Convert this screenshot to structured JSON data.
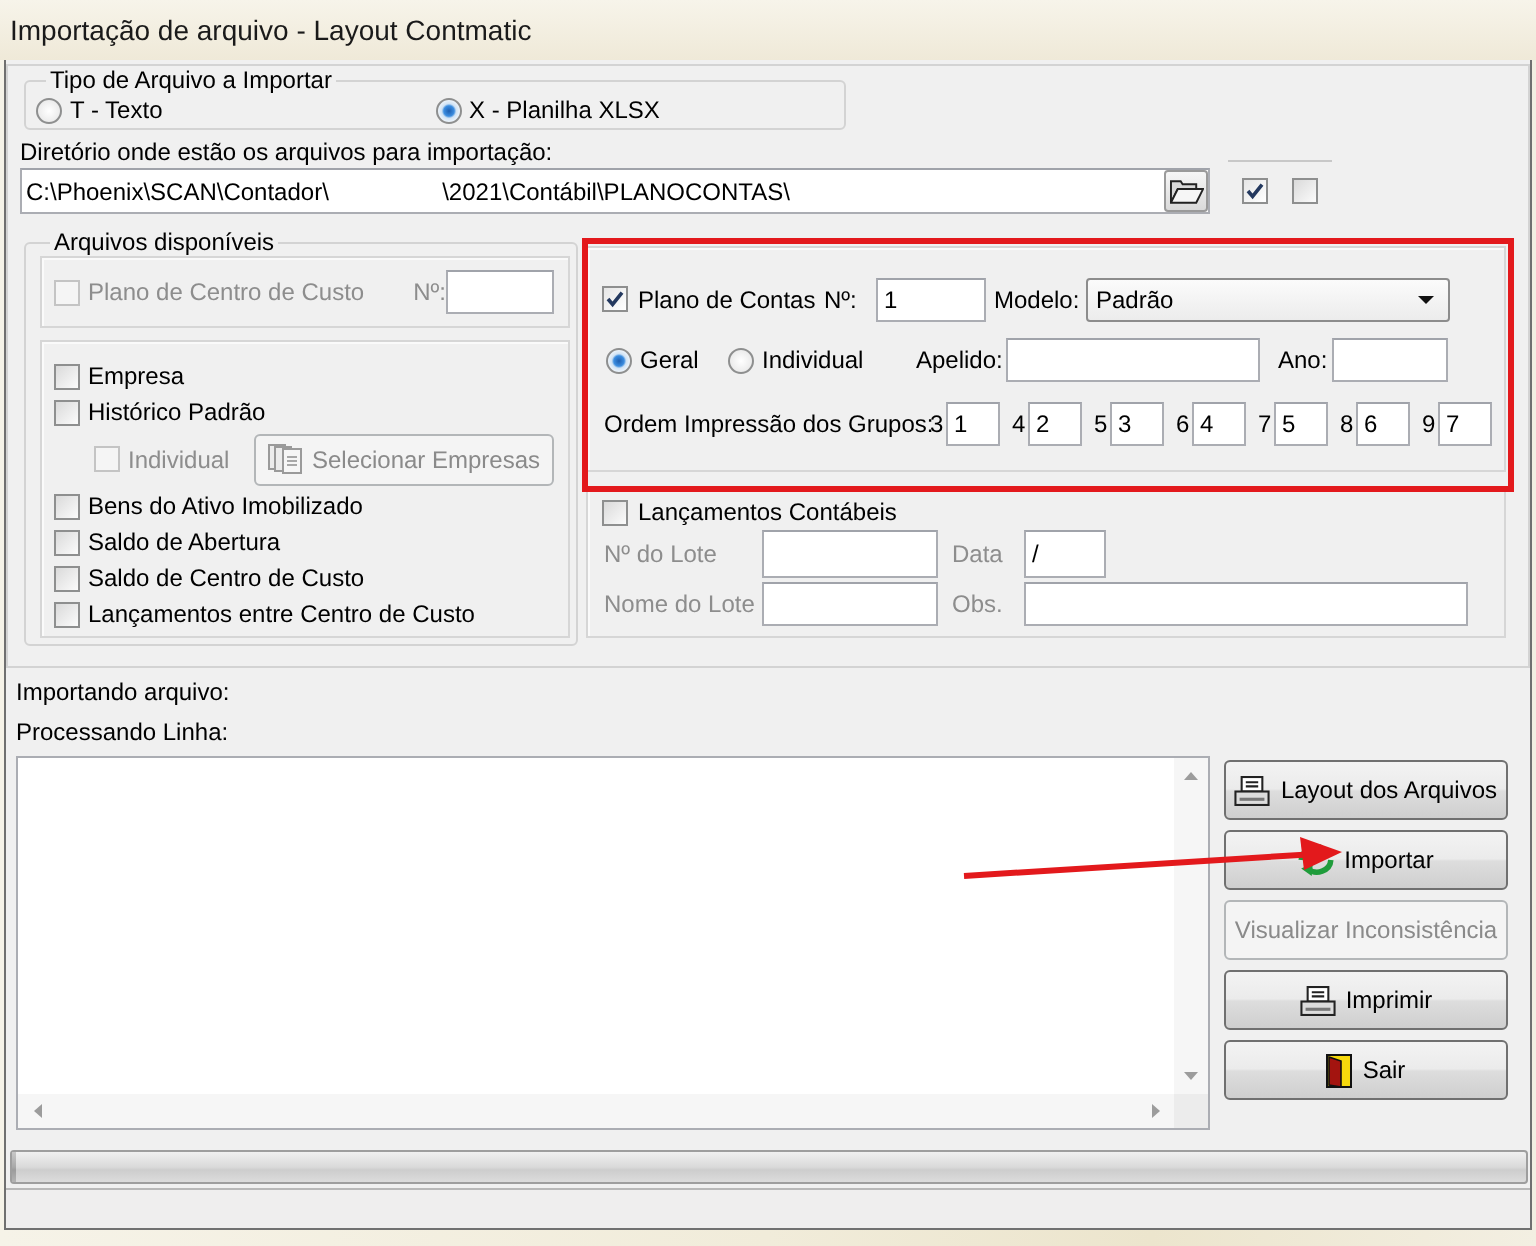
{
  "window": {
    "title": "Importação de arquivo - Layout Contmatic"
  },
  "file_type": {
    "legend": "Tipo de Arquivo a Importar",
    "options": [
      {
        "label": "T - Texto",
        "selected": false
      },
      {
        "label": "X - Planilha XLSX",
        "selected": true
      }
    ]
  },
  "directory": {
    "label": "Diretório onde estão os arquivos para importação:",
    "value": "C:\\Phoenix\\SCAN\\Contador\\                 \\2021\\Contábil\\PLANOCONTAS\\",
    "toggles": [
      {
        "checked": true
      },
      {
        "checked": false
      }
    ]
  },
  "available_files": {
    "legend": "Arquivos disponíveis",
    "cost_center_plan": {
      "label": "Plano de Centro de Custo",
      "number_label": "Nº:",
      "checked": false,
      "disabled": true
    },
    "items": [
      {
        "kind": "checkbox",
        "label": "Empresa",
        "checked": false,
        "disabled": false
      },
      {
        "kind": "checkbox",
        "label": "Histórico Padrão",
        "checked": false,
        "disabled": false
      },
      {
        "kind": "sub_option",
        "label": "Individual",
        "checked": false,
        "disabled": true,
        "button": {
          "label": "Selecionar Empresas",
          "disabled": true
        }
      },
      {
        "kind": "checkbox",
        "label": "Bens do Ativo Imobilizado",
        "checked": false,
        "disabled": false
      },
      {
        "kind": "checkbox",
        "label": "Saldo de Abertura",
        "checked": false,
        "disabled": false
      },
      {
        "kind": "checkbox",
        "label": "Saldo de Centro de Custo",
        "checked": false,
        "disabled": false
      },
      {
        "kind": "checkbox",
        "label": "Lançamentos entre Centro de Custo",
        "checked": false,
        "disabled": false
      }
    ]
  },
  "chart_of_accounts": {
    "label": "Plano de Contas",
    "checked": true,
    "number_label": "Nº:",
    "number": "1",
    "model_label": "Modelo:",
    "model": "Padrão",
    "scope": [
      {
        "label": "Geral",
        "selected": true
      },
      {
        "label": "Individual",
        "selected": false
      }
    ],
    "nickname_label": "Apelido:",
    "year_label": "Ano:",
    "order_label": "Ordem Impressão dos Grupos:",
    "order": [
      {
        "group": "3",
        "value": "1"
      },
      {
        "group": "4",
        "value": "2"
      },
      {
        "group": "5",
        "value": "3"
      },
      {
        "group": "6",
        "value": "4"
      },
      {
        "group": "7",
        "value": "5"
      },
      {
        "group": "8",
        "value": "6"
      },
      {
        "group": "9",
        "value": "7"
      }
    ]
  },
  "accounting_entries": {
    "label": "Lançamentos Contábeis",
    "checked": false,
    "fields_disabled": true,
    "batch_number_label": "Nº do Lote",
    "date_label": "Data",
    "date": "/",
    "batch_name_label": "Nome do Lote",
    "notes_label": "Obs."
  },
  "import_status": {
    "file_label": "Importando arquivo:",
    "line_label": "Processando Linha:"
  },
  "buttons": [
    {
      "kind": "layout",
      "label": "Layout dos Arquivos",
      "disabled": false
    },
    {
      "kind": "import",
      "label": "Importar",
      "disabled": false
    },
    {
      "kind": "inconsistency",
      "label": "Visualizar Inconsistência",
      "disabled": true
    },
    {
      "kind": "print",
      "label": "Imprimir",
      "disabled": false
    },
    {
      "kind": "exit",
      "label": "Sair",
      "disabled": false
    }
  ],
  "progress": {
    "level": 0
  },
  "annotations": {
    "highlight_frame": true,
    "pointer_arrow": true
  }
}
